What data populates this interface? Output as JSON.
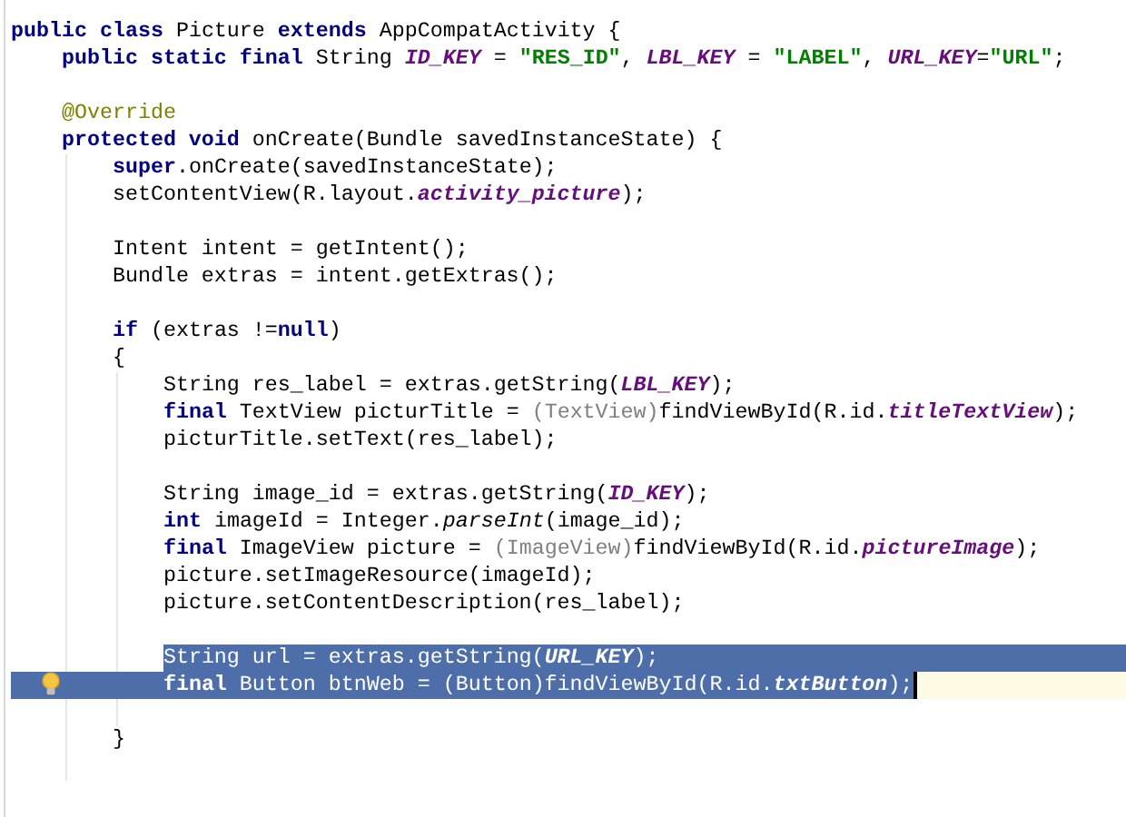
{
  "editor": {
    "lines": [
      {
        "kind": "code",
        "selected": false,
        "caret": false,
        "bulb": false,
        "tokens": [
          {
            "text": "public class",
            "kind": "keyword"
          },
          {
            "text": " Picture ",
            "kind": "plain"
          },
          {
            "text": "extends",
            "kind": "keyword"
          },
          {
            "text": " AppCompatActivity {",
            "kind": "plain"
          }
        ]
      },
      {
        "kind": "code",
        "selected": false,
        "caret": false,
        "bulb": false,
        "tokens": [
          {
            "text": "    public static final",
            "kind": "keyword"
          },
          {
            "text": " String ",
            "kind": "plain"
          },
          {
            "text": "ID_KEY",
            "kind": "constant"
          },
          {
            "text": " = ",
            "kind": "plain"
          },
          {
            "text": "\"RES_ID\"",
            "kind": "string"
          },
          {
            "text": ", ",
            "kind": "plain"
          },
          {
            "text": "LBL_KEY",
            "kind": "constant"
          },
          {
            "text": " = ",
            "kind": "plain"
          },
          {
            "text": "\"LABEL\"",
            "kind": "string"
          },
          {
            "text": ", ",
            "kind": "plain"
          },
          {
            "text": "URL_KEY",
            "kind": "constant"
          },
          {
            "text": "=",
            "kind": "plain"
          },
          {
            "text": "\"URL\"",
            "kind": "string"
          },
          {
            "text": ";",
            "kind": "plain"
          }
        ]
      },
      {
        "kind": "blank"
      },
      {
        "kind": "code",
        "selected": false,
        "caret": false,
        "bulb": false,
        "tokens": [
          {
            "text": "    @Override",
            "kind": "annotation"
          }
        ]
      },
      {
        "kind": "code",
        "selected": false,
        "caret": false,
        "bulb": false,
        "tokens": [
          {
            "text": "    protected void",
            "kind": "keyword"
          },
          {
            "text": " onCreate(Bundle savedInstanceState) {",
            "kind": "plain"
          }
        ]
      },
      {
        "kind": "code",
        "selected": false,
        "caret": false,
        "bulb": false,
        "tokens": [
          {
            "text": "        super",
            "kind": "keyword"
          },
          {
            "text": ".onCreate(savedInstanceState);",
            "kind": "plain"
          }
        ]
      },
      {
        "kind": "code",
        "selected": false,
        "caret": false,
        "bulb": false,
        "tokens": [
          {
            "text": "        setContentView(R.layout.",
            "kind": "plain"
          },
          {
            "text": "activity_picture",
            "kind": "constant"
          },
          {
            "text": ");",
            "kind": "plain"
          }
        ]
      },
      {
        "kind": "blank"
      },
      {
        "kind": "code",
        "selected": false,
        "caret": false,
        "bulb": false,
        "tokens": [
          {
            "text": "        Intent intent = getIntent();",
            "kind": "plain"
          }
        ]
      },
      {
        "kind": "code",
        "selected": false,
        "caret": false,
        "bulb": false,
        "tokens": [
          {
            "text": "        Bundle extras = intent.getExtras();",
            "kind": "plain"
          }
        ]
      },
      {
        "kind": "blank"
      },
      {
        "kind": "code",
        "selected": false,
        "caret": false,
        "bulb": false,
        "tokens": [
          {
            "text": "        if",
            "kind": "keyword"
          },
          {
            "text": " (extras !=",
            "kind": "plain"
          },
          {
            "text": "null",
            "kind": "keyword"
          },
          {
            "text": ")",
            "kind": "plain"
          }
        ]
      },
      {
        "kind": "code",
        "selected": false,
        "caret": false,
        "bulb": false,
        "tokens": [
          {
            "text": "        {",
            "kind": "plain"
          }
        ]
      },
      {
        "kind": "code",
        "selected": false,
        "caret": false,
        "bulb": false,
        "tokens": [
          {
            "text": "            String res_label = extras.getString(",
            "kind": "plain"
          },
          {
            "text": "LBL_KEY",
            "kind": "constant"
          },
          {
            "text": ");",
            "kind": "plain"
          }
        ]
      },
      {
        "kind": "code",
        "selected": false,
        "caret": false,
        "bulb": false,
        "tokens": [
          {
            "text": "            final",
            "kind": "keyword"
          },
          {
            "text": " TextView picturTitle = ",
            "kind": "plain"
          },
          {
            "text": "(TextView)",
            "kind": "cast"
          },
          {
            "text": "findViewById(R.id.",
            "kind": "plain"
          },
          {
            "text": "titleTextView",
            "kind": "constant"
          },
          {
            "text": ");",
            "kind": "plain"
          }
        ]
      },
      {
        "kind": "code",
        "selected": false,
        "caret": false,
        "bulb": false,
        "tokens": [
          {
            "text": "            picturTitle.setText(res_label);",
            "kind": "plain"
          }
        ]
      },
      {
        "kind": "blank"
      },
      {
        "kind": "code",
        "selected": false,
        "caret": false,
        "bulb": false,
        "tokens": [
          {
            "text": "            String image_id = extras.getString(",
            "kind": "plain"
          },
          {
            "text": "ID_KEY",
            "kind": "constant"
          },
          {
            "text": ");",
            "kind": "plain"
          }
        ]
      },
      {
        "kind": "code",
        "selected": false,
        "caret": false,
        "bulb": false,
        "tokens": [
          {
            "text": "            int",
            "kind": "keyword"
          },
          {
            "text": " imageId = Integer.",
            "kind": "plain"
          },
          {
            "text": "parseInt",
            "kind": "static"
          },
          {
            "text": "(image_id);",
            "kind": "plain"
          }
        ]
      },
      {
        "kind": "code",
        "selected": false,
        "caret": false,
        "bulb": false,
        "tokens": [
          {
            "text": "            final",
            "kind": "keyword"
          },
          {
            "text": " ImageView picture = ",
            "kind": "plain"
          },
          {
            "text": "(ImageView)",
            "kind": "cast"
          },
          {
            "text": "findViewById(R.id.",
            "kind": "plain"
          },
          {
            "text": "pictureImage",
            "kind": "constant"
          },
          {
            "text": ");",
            "kind": "plain"
          }
        ]
      },
      {
        "kind": "code",
        "selected": false,
        "caret": false,
        "bulb": false,
        "tokens": [
          {
            "text": "            picture.setImageResource(imageId);",
            "kind": "plain"
          }
        ]
      },
      {
        "kind": "code",
        "selected": false,
        "caret": false,
        "bulb": false,
        "tokens": [
          {
            "text": "            picture.setContentDescription(res_label);",
            "kind": "plain"
          }
        ]
      },
      {
        "kind": "blank"
      },
      {
        "kind": "code",
        "selected": true,
        "caret": false,
        "bulb": false,
        "tokens": [
          {
            "text": "            String url = extras.getString(",
            "kind": "plain"
          },
          {
            "text": "URL_KEY",
            "kind": "constant"
          },
          {
            "text": ");",
            "kind": "plain"
          }
        ]
      },
      {
        "kind": "code",
        "selected": true,
        "caret": true,
        "bulb": true,
        "tokens": [
          {
            "text": "            final",
            "kind": "keyword"
          },
          {
            "text": " Button btnWeb = (Button)findViewById(R.id.",
            "kind": "plain"
          },
          {
            "text": "txtButton",
            "kind": "constant"
          },
          {
            "text": ");",
            "kind": "plain"
          }
        ]
      },
      {
        "kind": "blank"
      },
      {
        "kind": "code",
        "selected": false,
        "caret": false,
        "bulb": false,
        "tokens": [
          {
            "text": "        }",
            "kind": "plain"
          }
        ]
      }
    ]
  }
}
